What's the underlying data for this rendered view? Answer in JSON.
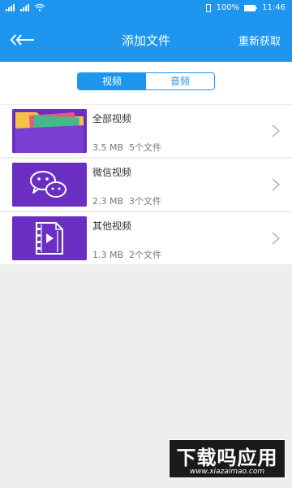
{
  "status_bar": {
    "battery": "100%",
    "time": "11:46"
  },
  "toolbar": {
    "title": "添加文件",
    "refresh_label": "重新获取"
  },
  "tabs": [
    {
      "label": "视频",
      "active": true
    },
    {
      "label": "音频",
      "active": false
    }
  ],
  "items": [
    {
      "title": "全部视频",
      "size": "3.5 MB",
      "count": "5个文件",
      "icon": "folder-icon"
    },
    {
      "title": "微信视频",
      "size": "2.3 MB",
      "count": "3个文件",
      "icon": "wechat-icon"
    },
    {
      "title": "其他视频",
      "size": "1.3 MB",
      "count": "2个文件",
      "icon": "video-file-icon"
    }
  ],
  "watermark": {
    "big": "下载吗应用",
    "small": "www.xiazaimao.com"
  },
  "colors": {
    "accent": "#1e96f0",
    "thumb": "#6a2fc2"
  }
}
